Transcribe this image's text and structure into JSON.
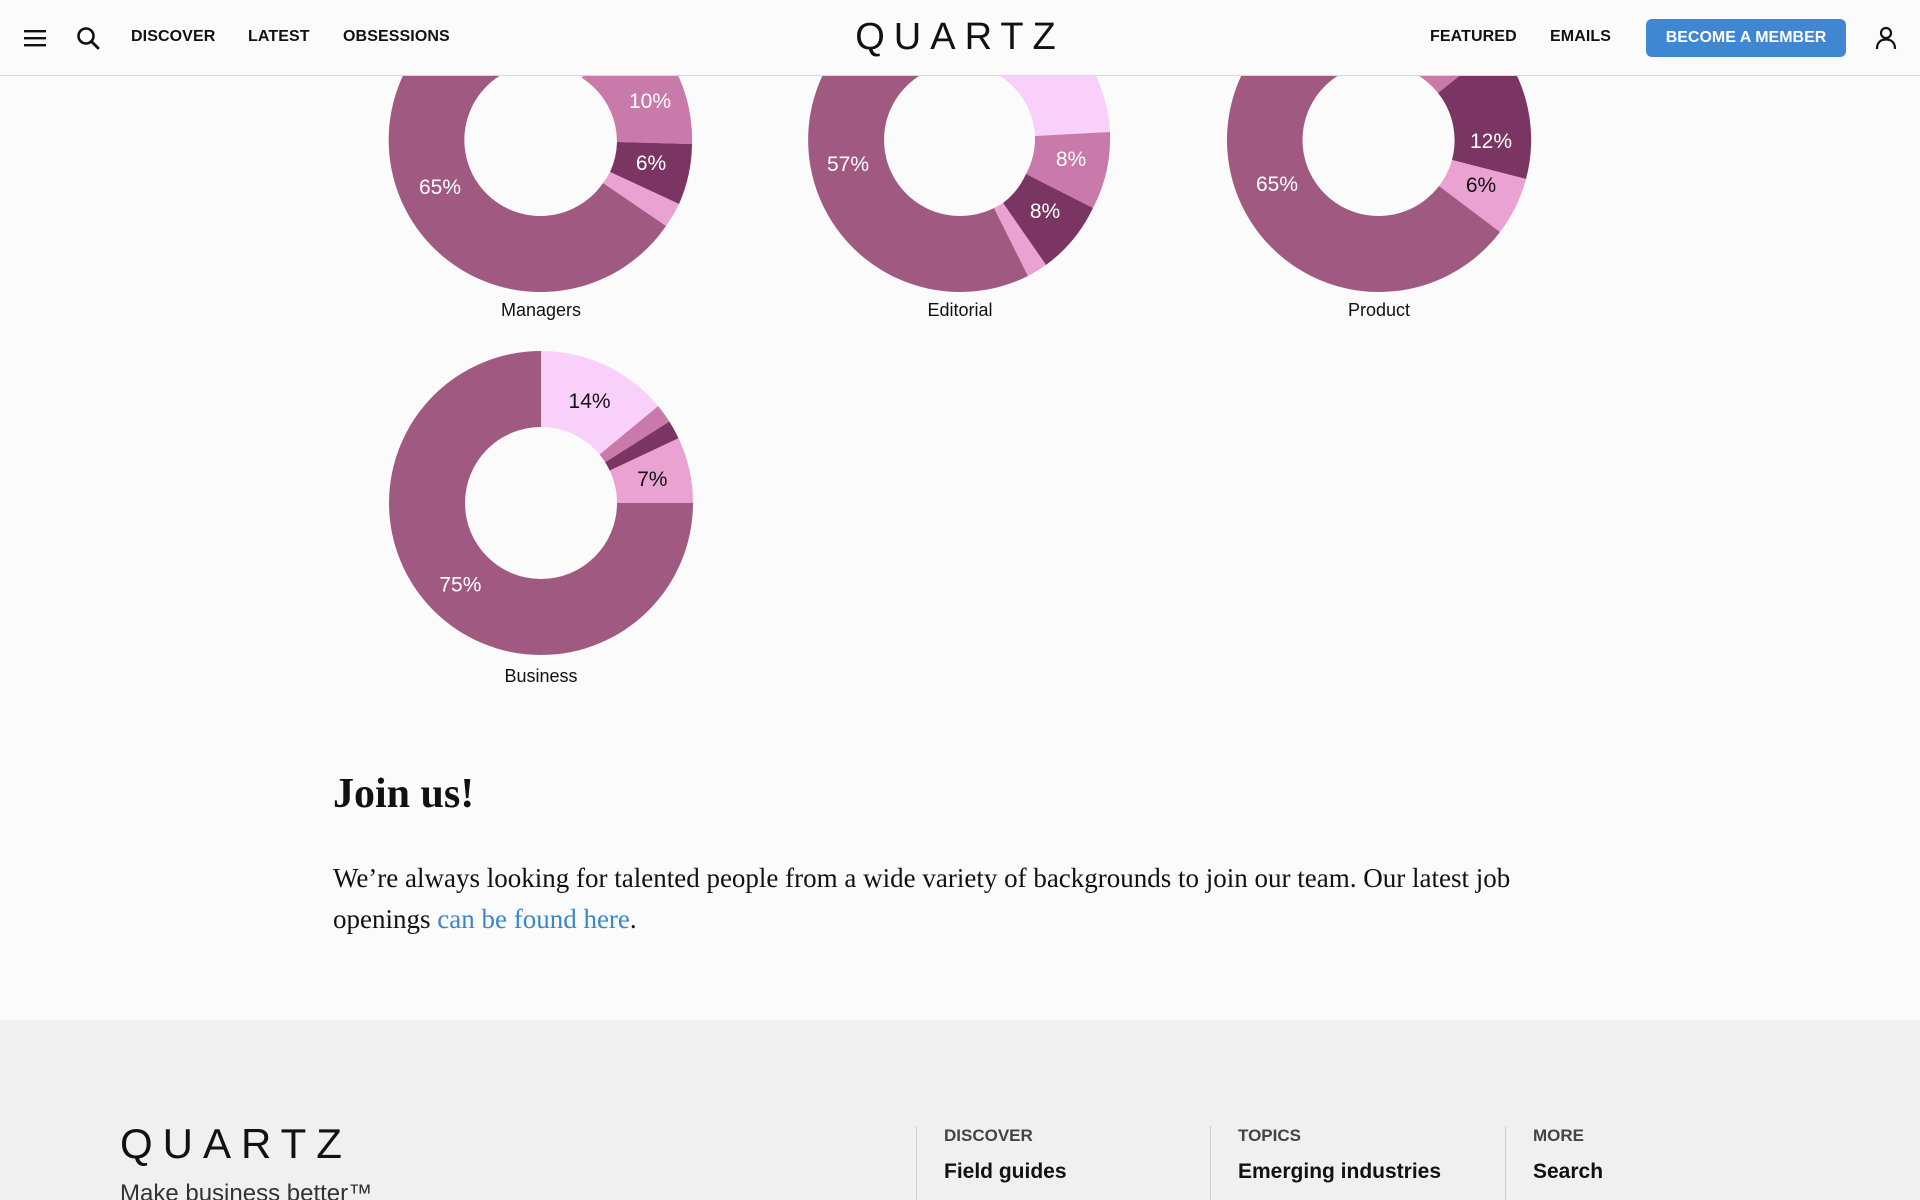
{
  "header": {
    "menu_icon": "hamburger-menu-icon",
    "search_icon": "search-icon",
    "nav_left": [
      "DISCOVER",
      "LATEST",
      "OBSESSIONS"
    ],
    "logo": "QUARTZ",
    "nav_right": [
      "FEATURED",
      "EMAILS"
    ],
    "member_button": "BECOME A MEMBER",
    "account_icon": "user-icon",
    "accent_color": "#3f86d3"
  },
  "chart_data": [
    {
      "type": "pie",
      "title": "Managers",
      "visible_labels": [
        "10%",
        "6%",
        "65%"
      ],
      "note": "donut, top cropped"
    },
    {
      "type": "pie",
      "title": "Editorial",
      "visible_labels": [
        "57%",
        "8%",
        "8%"
      ]
    },
    {
      "type": "pie",
      "title": "Product",
      "visible_labels": [
        "12%",
        "6%",
        "65%"
      ]
    },
    {
      "type": "pie",
      "title": "Business",
      "slices": [
        {
          "label": "14%",
          "value": 14,
          "color": "#f9d0f9"
        },
        {
          "label": "",
          "value": 2,
          "color": "#c97aaa"
        },
        {
          "label": "",
          "value": 2,
          "color": "#7a3562"
        },
        {
          "label": "7%",
          "value": 7,
          "color": "#eaa2d2"
        },
        {
          "label": "75%",
          "value": 75,
          "color": "#a05a82"
        }
      ]
    }
  ],
  "join": {
    "title": "Join us!",
    "text": "We’re always looking for talented people from a wide variety of backgrounds to join our team. Our latest job openings ",
    "link": "can be found here",
    "end": "."
  },
  "footer": {
    "logo": "QUARTZ",
    "tagline": "Make business better™",
    "columns": [
      {
        "heading": "DISCOVER",
        "link": "Field guides"
      },
      {
        "heading": "TOPICS",
        "link": "Emerging industries"
      },
      {
        "heading": "MORE",
        "link": "Search"
      }
    ]
  }
}
